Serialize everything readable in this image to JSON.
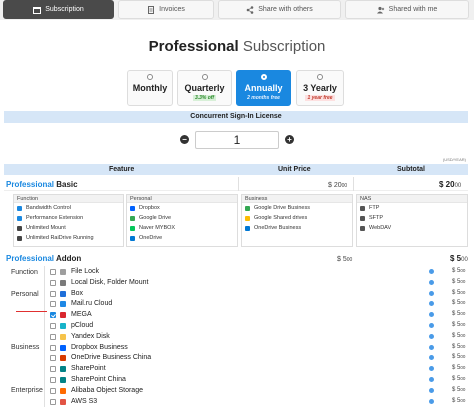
{
  "tabs": [
    {
      "label": "Subscription",
      "icon": "calendar-icon",
      "active": true
    },
    {
      "label": "Invoices",
      "icon": "document-icon",
      "active": false
    },
    {
      "label": "Share with others",
      "icon": "share-icon",
      "active": false
    },
    {
      "label": "Shared with me",
      "icon": "users-icon",
      "active": false
    }
  ],
  "title": {
    "bold": "Professional",
    "light": "Subscription"
  },
  "plans": [
    {
      "name": "Monthly",
      "note": "",
      "selected": false
    },
    {
      "name": "Quarterly",
      "note": "3.3% off",
      "selected": false
    },
    {
      "name": "Annually",
      "note": "2 months free",
      "selected": true
    },
    {
      "name": "3 Yearly",
      "note": "1 year free",
      "selected": false
    }
  ],
  "signin": {
    "label": "Concurrent Sign-In License",
    "quantity": "1",
    "minus": "−",
    "plus": "+",
    "unit_note": "(USD/YEAR)"
  },
  "table": {
    "feature": "Feature",
    "unit_price": "Unit Price",
    "subtotal": "Subtotal"
  },
  "basic": {
    "title_hl": "Professional",
    "title_rest": "Basic",
    "price": "$ 20",
    "price_suffix": "00",
    "subtotal": "$ 20",
    "subtotal_suffix": "00",
    "groups": [
      {
        "title": "Function",
        "items": [
          "Bandwidth Control",
          "Performance Extension",
          "Unlimited Mount",
          "Unlimited RaiDrive Running"
        ]
      },
      {
        "title": "Personal",
        "items": [
          "Dropbox",
          "Google Drive",
          "Naver MYBOX",
          "OneDrive"
        ]
      },
      {
        "title": "Business",
        "items": [
          "Google Drive Business",
          "Google Shared drives",
          "OneDrive Business"
        ]
      },
      {
        "title": "NAS",
        "items": [
          "FTP",
          "SFTP",
          "WebDAV"
        ]
      }
    ]
  },
  "addon": {
    "title_hl": "Professional",
    "title_rest": "Addon",
    "price": "$ 5",
    "price_suffix": "00",
    "subtotal": "$ 5",
    "subtotal_suffix": "00",
    "categories": [
      "Function",
      "Personal",
      "Business",
      "Enterprise"
    ],
    "items": [
      {
        "name": "File Lock",
        "price": "$ 5",
        "suffix": "00",
        "checked": false,
        "color": "#9e9e9e"
      },
      {
        "name": "Local Disk, Folder Mount",
        "price": "$ 5",
        "suffix": "00",
        "checked": false,
        "color": "#7a7a7a"
      },
      {
        "name": "Box",
        "price": "$ 5",
        "suffix": "00",
        "checked": false,
        "color": "#1e6fd9"
      },
      {
        "name": "Mail.ru Cloud",
        "price": "$ 5",
        "suffix": "00",
        "checked": false,
        "color": "#1e88e5"
      },
      {
        "name": "MEGA",
        "price": "$ 5",
        "suffix": "00",
        "checked": true,
        "color": "#d9272e"
      },
      {
        "name": "pCloud",
        "price": "$ 5",
        "suffix": "00",
        "checked": false,
        "color": "#17b3c9"
      },
      {
        "name": "Yandex Disk",
        "price": "$ 5",
        "suffix": "00",
        "checked": false,
        "color": "#f6c34a"
      },
      {
        "name": "Dropbox Business",
        "price": "$ 5",
        "suffix": "00",
        "checked": false,
        "color": "#0061fe"
      },
      {
        "name": "OneDrive Business China",
        "price": "$ 5",
        "suffix": "00",
        "checked": false,
        "color": "#d83b01"
      },
      {
        "name": "SharePoint",
        "price": "$ 5",
        "suffix": "00",
        "checked": false,
        "color": "#038387"
      },
      {
        "name": "SharePoint China",
        "price": "$ 5",
        "suffix": "00",
        "checked": false,
        "color": "#038387"
      },
      {
        "name": "Alibaba Object Storage",
        "price": "$ 5",
        "suffix": "00",
        "checked": false,
        "color": "#ff6a00"
      },
      {
        "name": "AWS S3",
        "price": "$ 5",
        "suffix": "00",
        "checked": false,
        "color": "#e25444"
      }
    ]
  }
}
